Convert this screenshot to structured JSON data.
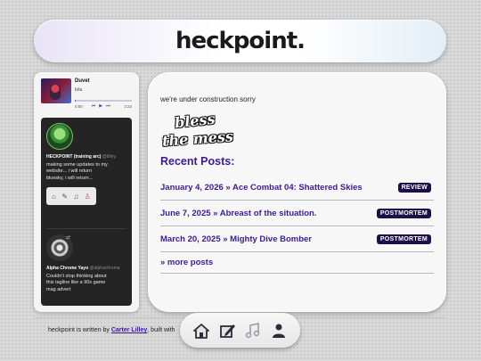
{
  "header": {
    "logo": "heckpoint."
  },
  "player": {
    "track_title": "Duvet",
    "artist": "bôa",
    "time_current": "0:00",
    "time_total": "3:23",
    "progress": 0.02
  },
  "feed": {
    "posts": [
      {
        "author": "HECKPOINT (training arc)",
        "handle": "@tilley.",
        "text": "making some updates to my website... i will return bluesky, i will return..."
      },
      {
        "author": "Alpha Chrome Yayo",
        "handle": "@alphachrome",
        "text": "Couldn't stop thinking about this tagline like a 90s game mag advert"
      }
    ]
  },
  "main": {
    "notice": "we're under construction sorry",
    "stamp_line1": "bless",
    "stamp_line2": "the mess",
    "recent_title": "Recent Posts:",
    "posts": [
      {
        "title": "January 4, 2026 » Ace Combat 04: Shattered Skies",
        "tag": "REVIEW"
      },
      {
        "title": "June 7, 2025 » Abreast of the situation.",
        "tag": "POSTMORTEM"
      },
      {
        "title": "March 20, 2025 » Mighty Dive Bomber",
        "tag": "POSTMORTEM"
      }
    ],
    "more_posts": "» more posts"
  },
  "footer": {
    "prefix": "heckpoint is written by ",
    "author": "Carter Lilley",
    "suffix": ", built with"
  },
  "dock": {
    "icons": [
      "home-icon",
      "edit-icon",
      "music-icon",
      "person-icon"
    ]
  }
}
